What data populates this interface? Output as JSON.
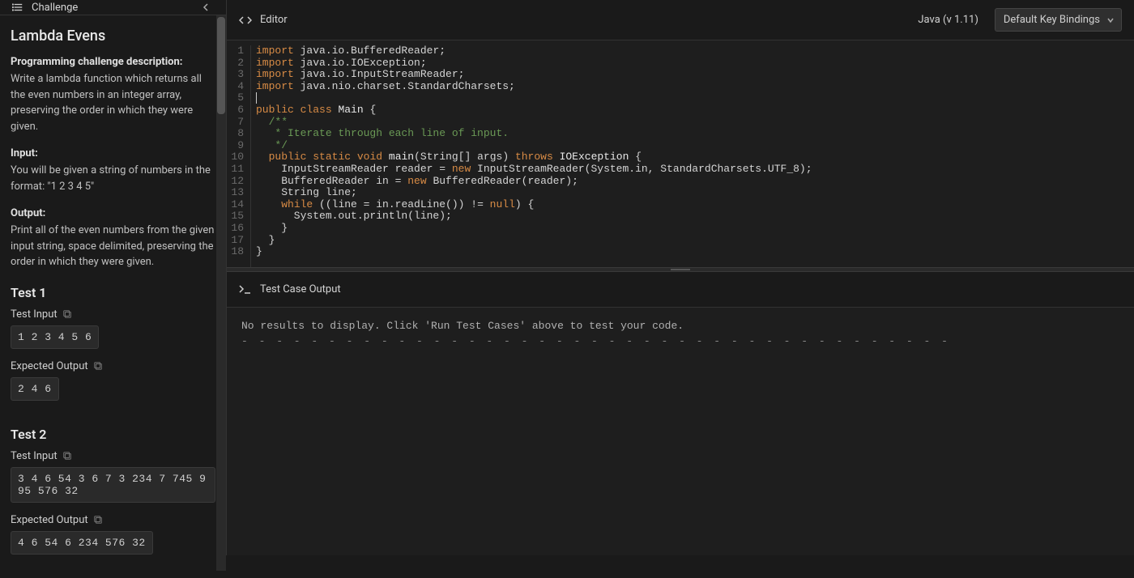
{
  "sidebar": {
    "header_label": "Challenge",
    "challenge_title": "Lambda Evens",
    "desc_heading": "Programming challenge description:",
    "desc_body": "Write a lambda function which returns all the even numbers in an integer array, preserving the order in which they were given.",
    "input_heading": "Input:",
    "input_body": "You will be given a string of numbers in the format: \"1 2 3 4 5\"",
    "output_heading": "Output:",
    "output_body": "Print all of the even numbers from the given input string, space delimited, preserving the order in which they were given.",
    "test1_heading": "Test 1",
    "test_input_label": "Test Input",
    "expected_output_label": "Expected Output",
    "test1_input": "1 2 3 4 5 6",
    "test1_expected": "2 4 6",
    "test2_heading": "Test 2",
    "test2_input": "3 4 6 54 3 6 7 3 234 7 745 995 576 32",
    "test2_expected": "4 6 54 6 234 576 32"
  },
  "editor": {
    "header_label": "Editor",
    "language": "Java (v 1.11)",
    "keybindings": "Default Key Bindings",
    "lines": [
      [
        [
          "kw",
          "import"
        ],
        [
          "",
          " java.io.BufferedReader;"
        ]
      ],
      [
        [
          "kw",
          "import"
        ],
        [
          "",
          " java.io.IOException;"
        ]
      ],
      [
        [
          "kw",
          "import"
        ],
        [
          "",
          " java.io.InputStreamReader;"
        ]
      ],
      [
        [
          "kw",
          "import"
        ],
        [
          "",
          " java.nio.charset.StandardCharsets;"
        ]
      ],
      [
        [
          "cursor",
          ""
        ]
      ],
      [
        [
          "kw",
          "public"
        ],
        [
          "",
          " "
        ],
        [
          "kw",
          "class"
        ],
        [
          "",
          " "
        ],
        [
          "cls",
          "Main"
        ],
        [
          "",
          " {"
        ]
      ],
      [
        [
          "cmt",
          "  /**"
        ]
      ],
      [
        [
          "cmt",
          "   * Iterate through each line of input."
        ]
      ],
      [
        [
          "cmt",
          "   */"
        ]
      ],
      [
        [
          "",
          "  "
        ],
        [
          "kw",
          "public"
        ],
        [
          "",
          " "
        ],
        [
          "kw",
          "static"
        ],
        [
          "",
          " "
        ],
        [
          "kw",
          "void"
        ],
        [
          "",
          " "
        ],
        [
          "fn",
          "main"
        ],
        [
          "",
          "(String[] args) "
        ],
        [
          "kw",
          "throws"
        ],
        [
          "",
          " "
        ],
        [
          "cls",
          "IOException"
        ],
        [
          "",
          " {"
        ]
      ],
      [
        [
          "",
          "    InputStreamReader reader = "
        ],
        [
          "kw",
          "new"
        ],
        [
          "",
          " InputStreamReader(System.in, StandardCharsets.UTF_8);"
        ]
      ],
      [
        [
          "",
          "    BufferedReader in = "
        ],
        [
          "kw",
          "new"
        ],
        [
          "",
          " BufferedReader(reader);"
        ]
      ],
      [
        [
          "",
          "    String line;"
        ]
      ],
      [
        [
          "",
          "    "
        ],
        [
          "kw",
          "while"
        ],
        [
          "",
          " ((line = in.readLine()) != "
        ],
        [
          "kw",
          "null"
        ],
        [
          "",
          ") {"
        ]
      ],
      [
        [
          "",
          "      System.out.println(line);"
        ]
      ],
      [
        [
          "",
          "    }"
        ]
      ],
      [
        [
          "",
          "  }"
        ]
      ],
      [
        [
          "",
          "}"
        ]
      ]
    ]
  },
  "output": {
    "header_label": "Test Case Output",
    "no_results": "No results to display. Click 'Run Test Cases' above to test your code.",
    "dashes": "- - - - - - - - - - - - - - - - - - - - - - - - - - - - - - - - - - - - - - - - -"
  }
}
